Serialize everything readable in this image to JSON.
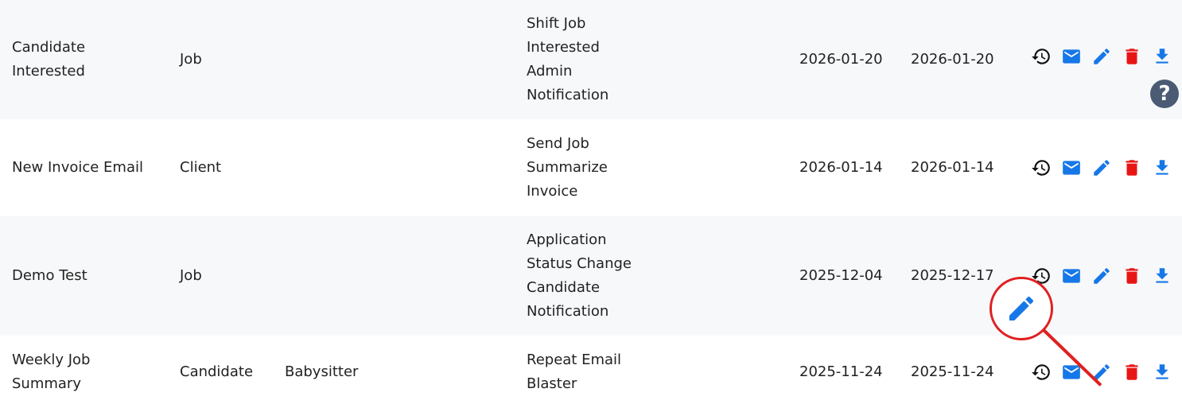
{
  "colors": {
    "row_alt": "#f7f8fa",
    "icon_blue": "#1677e8",
    "icon_red": "#e81515",
    "icon_dark": "#111111",
    "help_bg": "#4a5b73",
    "annotation": "#e02020"
  },
  "rows": [
    {
      "name": "Candidate\nInterested",
      "type": "Job",
      "category": "",
      "trigger": "Shift Job\nInterested\nAdmin\nNotification",
      "created": "2026-01-20",
      "updated": "2026-01-20"
    },
    {
      "name": "New Invoice Email",
      "type": "Client",
      "category": "",
      "trigger": "Send Job\nSummarize\nInvoice",
      "created": "2026-01-14",
      "updated": "2026-01-14"
    },
    {
      "name": "Demo Test",
      "type": "Job",
      "category": "",
      "trigger": "Application\nStatus Change\nCandidate\nNotification",
      "created": "2025-12-04",
      "updated": "2025-12-17"
    },
    {
      "name": "Weekly Job\nSummary",
      "type": "Candidate",
      "category": "Babysitter",
      "trigger": "Repeat Email\nBlaster",
      "created": "2025-11-24",
      "updated": "2025-11-24"
    }
  ],
  "actions": [
    "history-icon",
    "email-icon",
    "edit-icon",
    "delete-icon",
    "download-icon"
  ],
  "help": {
    "label": "?"
  }
}
